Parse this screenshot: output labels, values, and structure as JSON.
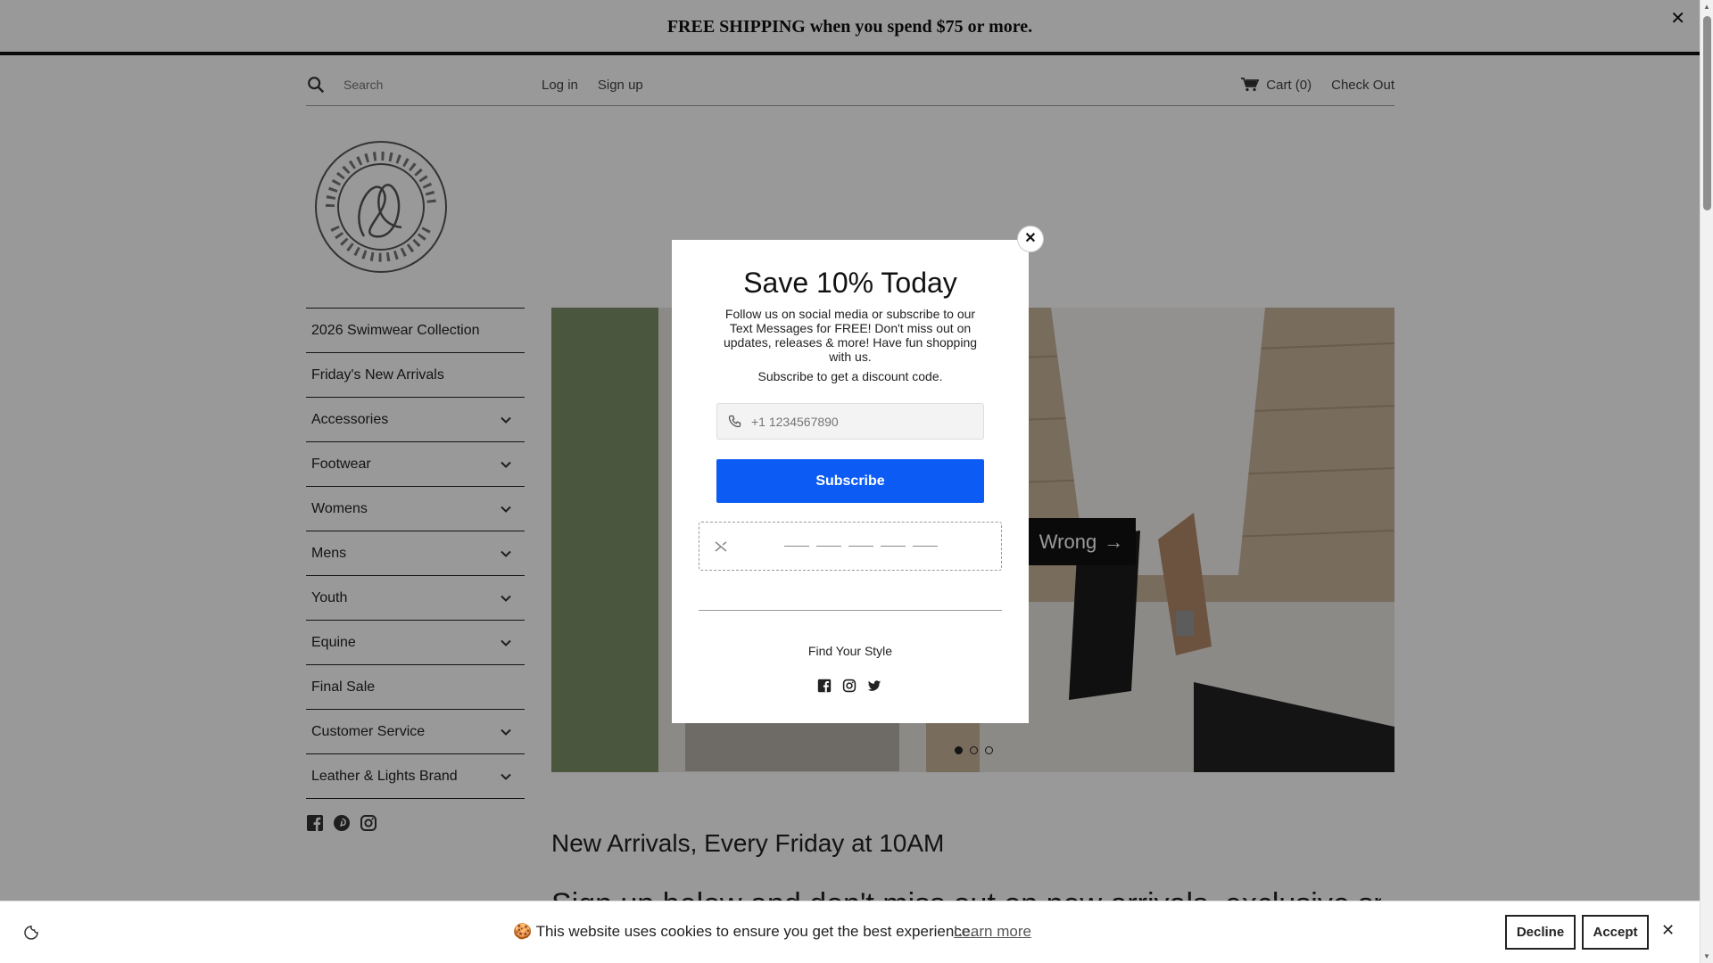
{
  "announcement": {
    "text": "FREE SHIPPING when you spend $75 or more.",
    "close": "✕"
  },
  "header": {
    "search_placeholder": "Search",
    "login": "Log in",
    "signup": "Sign up",
    "cart": "Cart (0)",
    "checkout": "Check Out"
  },
  "logo": {
    "alt_text": "LEATHER AND LIGHTS"
  },
  "sidebar": {
    "items": [
      {
        "label": "2026 Swimwear Collection",
        "has_children": false
      },
      {
        "label": "Friday's New Arrivals",
        "has_children": false
      },
      {
        "label": "Accessories",
        "has_children": true
      },
      {
        "label": "Footwear",
        "has_children": true
      },
      {
        "label": "Womens",
        "has_children": true
      },
      {
        "label": "Mens",
        "has_children": true
      },
      {
        "label": "Youth",
        "has_children": true
      },
      {
        "label": "Equine",
        "has_children": true
      },
      {
        "label": "Final Sale",
        "has_children": false
      },
      {
        "label": "Customer Service",
        "has_children": true
      },
      {
        "label": "Leather & Lights Brand",
        "has_children": true
      }
    ],
    "social_icons": [
      "facebook-icon",
      "pinterest-icon",
      "instagram-icon"
    ]
  },
  "hero": {
    "cta_label": "Wrong",
    "cta_arrow": "→",
    "slides_total": 3,
    "active_slide": 1
  },
  "content": {
    "heading": "New Arrivals, Every Friday at 10AM",
    "subheading": "Sign up below and don't miss out on new arrivals, exclusive sneak"
  },
  "popup": {
    "title": "Save 10% Today",
    "description": "Follow us on social media or subscribe to our Text Messages for FREE! Don't miss out on updates, releases & more! Have fun shopping with us.",
    "sub_note": "Subscribe to get a discount code.",
    "phone_placeholder": "+1 1234567890",
    "subscribe_label": "Subscribe",
    "find_style": "Find Your Style",
    "close": "✕",
    "accent_color": "#0d5bf5"
  },
  "cookie": {
    "message": "🍪 This website uses cookies to ensure you get the best experience.",
    "learn_more": "Learn more",
    "decline": "Decline",
    "accept": "Accept",
    "close": "✕"
  }
}
